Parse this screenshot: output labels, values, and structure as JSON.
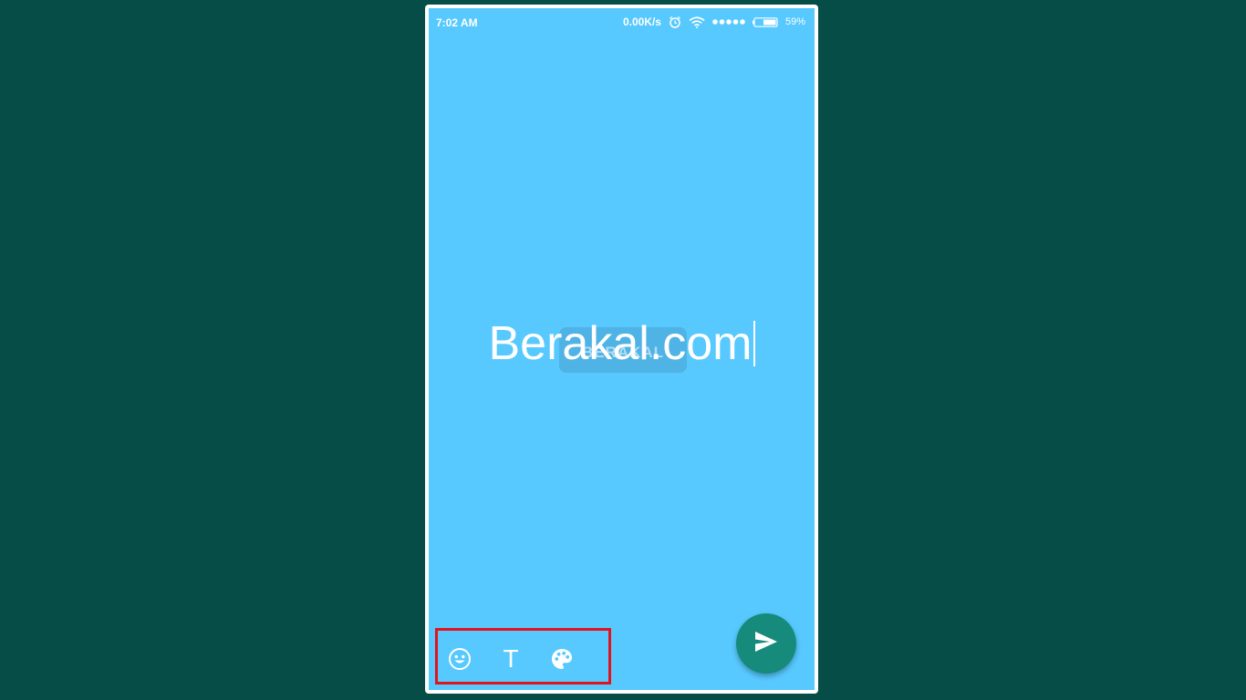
{
  "status_bar": {
    "time": "7:02 AM",
    "network_speed": "0.00K/s",
    "battery_percent": "59%",
    "icons": [
      "alarm-icon",
      "wifi-icon",
      "signal-icon",
      "battery-icon"
    ]
  },
  "editor": {
    "text_value": "Berakal.com",
    "background_color": "#57c9fe",
    "watermark_text": "BERAKAL"
  },
  "toolbar": {
    "tools": [
      {
        "name": "emoji",
        "icon": "smiley-icon"
      },
      {
        "name": "font",
        "icon": "text-t-icon",
        "glyph": "T"
      },
      {
        "name": "color",
        "icon": "palette-icon"
      }
    ],
    "highlight_color": "#e3131b"
  },
  "send_button": {
    "icon": "send-icon",
    "color": "#168b7b"
  },
  "colors": {
    "page_background": "#064c47",
    "frame": "#ffffff"
  }
}
